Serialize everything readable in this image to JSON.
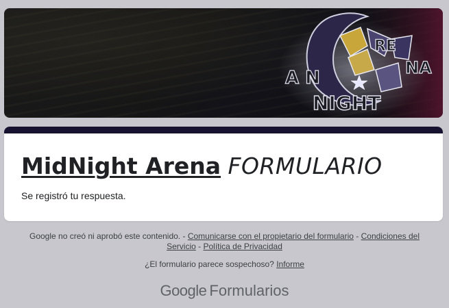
{
  "banner": {
    "logo_text": "MidNight Arena"
  },
  "form": {
    "title_brand": "MidNight Arena",
    "title_rest": "FORMULARIO",
    "confirmation": "Se registró tu respuesta."
  },
  "footer": {
    "disclaimer_prefix": "Google no creó ni aprobó este contenido.",
    "sep1": " - ",
    "contact_link": "Comunicarse con el propietario del formulario",
    "sep2": " - ",
    "terms_link": "Condiciones del Servicio",
    "sep3": " - ",
    "privacy_link": "Política de Privacidad",
    "suspicious_text": "¿El formulario parece sospechoso?",
    "report_link": "Informe",
    "brand_google": "Google",
    "brand_product": "Formularios"
  },
  "colors": {
    "page_background": "#c8c7cd",
    "accent_bar": "#161230",
    "card_background": "#ffffff"
  }
}
